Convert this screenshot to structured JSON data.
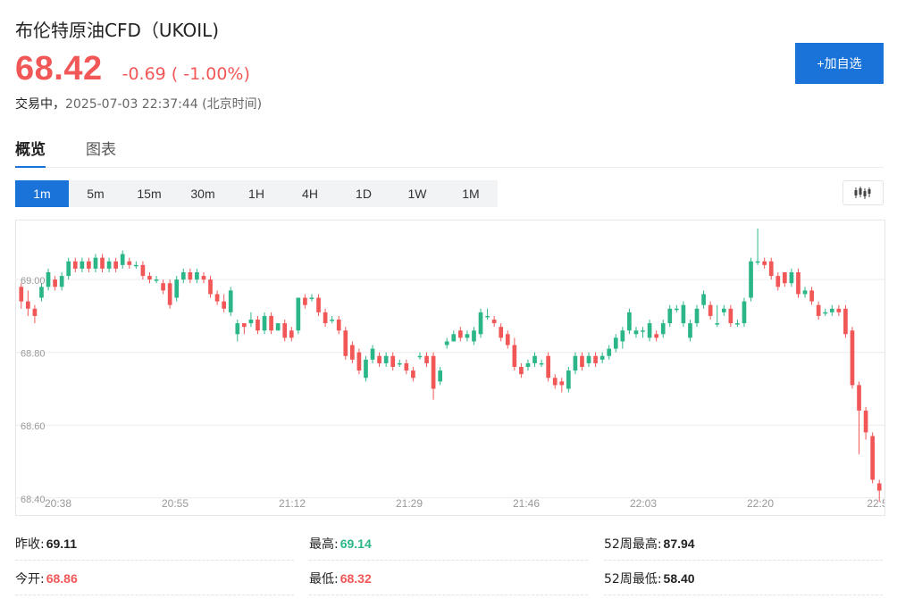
{
  "header": {
    "title": "布伦特原油CFD（UKOIL)",
    "price": "68.42",
    "change": "-0.69 ( -1.00%)",
    "status": "交易中，",
    "timestamp": "2025-07-03 22:37:44 (北京时间)"
  },
  "watchlist_button": "+加自选",
  "tabs": [
    "概览",
    "图表"
  ],
  "intervals": [
    "1m",
    "5m",
    "15m",
    "30m",
    "1H",
    "4H",
    "1D",
    "1W",
    "1M"
  ],
  "active_interval": "1m",
  "chart_type_icon": "candlestick-icon",
  "colors": {
    "up": "#2bb68a",
    "down": "#f25757",
    "accent": "#1a73d9"
  },
  "chart_data": {
    "type": "candlestick",
    "x_ticks": [
      "20:38",
      "20:55",
      "21:12",
      "21:29",
      "21:46",
      "22:03",
      "22:20",
      "22:5"
    ],
    "y_ticks": [
      "69.00",
      "68.80",
      "68.60",
      "68.40"
    ],
    "ylim": [
      68.37,
      69.15
    ],
    "grid": true,
    "candles": [
      [
        68.98,
        68.94,
        68.99,
        68.92
      ],
      [
        68.94,
        68.92,
        68.97,
        68.9
      ],
      [
        68.92,
        68.9,
        68.93,
        68.88
      ],
      [
        68.95,
        68.98,
        68.99,
        68.94
      ],
      [
        68.98,
        69.02,
        69.03,
        68.97
      ],
      [
        69.0,
        68.98,
        69.01,
        68.97
      ],
      [
        68.98,
        69.01,
        69.02,
        68.97
      ],
      [
        69.01,
        69.05,
        69.06,
        69.0
      ],
      [
        69.05,
        69.03,
        69.06,
        69.02
      ],
      [
        69.03,
        69.05,
        69.06,
        69.02
      ],
      [
        69.05,
        69.03,
        69.06,
        69.02
      ],
      [
        69.03,
        69.06,
        69.07,
        69.02
      ],
      [
        69.06,
        69.03,
        69.07,
        69.02
      ],
      [
        69.03,
        69.05,
        69.06,
        69.02
      ],
      [
        69.05,
        69.03,
        69.06,
        69.02
      ],
      [
        69.04,
        69.07,
        69.08,
        69.03
      ],
      [
        69.05,
        69.04,
        69.06,
        69.03
      ],
      [
        69.04,
        69.04,
        69.05,
        69.03
      ],
      [
        69.04,
        69.01,
        69.05,
        69.0
      ],
      [
        69.01,
        69.0,
        69.02,
        68.99
      ],
      [
        69.0,
        69.0,
        69.01,
        68.99
      ],
      [
        68.99,
        68.97,
        69.0,
        68.96
      ],
      [
        68.99,
        68.93,
        69.0,
        68.92
      ],
      [
        68.95,
        69.0,
        69.01,
        68.94
      ],
      [
        69.0,
        69.02,
        69.03,
        68.99
      ],
      [
        69.02,
        69.0,
        69.03,
        68.99
      ],
      [
        69.0,
        69.02,
        69.03,
        68.99
      ],
      [
        69.01,
        69.0,
        69.02,
        68.99
      ],
      [
        69.0,
        68.96,
        69.01,
        68.95
      ],
      [
        68.96,
        68.94,
        68.97,
        68.93
      ],
      [
        68.94,
        68.92,
        68.96,
        68.91
      ],
      [
        68.91,
        68.97,
        68.98,
        68.9
      ],
      [
        68.85,
        68.88,
        68.89,
        68.83
      ],
      [
        68.88,
        68.87,
        68.88,
        68.85
      ],
      [
        68.88,
        68.89,
        68.91,
        68.87
      ],
      [
        68.89,
        68.86,
        68.9,
        68.85
      ],
      [
        68.86,
        68.9,
        68.91,
        68.85
      ],
      [
        68.9,
        68.86,
        68.91,
        68.85
      ],
      [
        68.86,
        68.88,
        68.88,
        68.86
      ],
      [
        68.88,
        68.84,
        68.89,
        68.83
      ],
      [
        68.86,
        68.84,
        68.87,
        68.83
      ],
      [
        68.86,
        68.95,
        68.95,
        68.85
      ],
      [
        68.95,
        68.93,
        68.96,
        68.92
      ],
      [
        68.95,
        68.95,
        68.96,
        68.94
      ],
      [
        68.95,
        68.91,
        68.96,
        68.9
      ],
      [
        68.91,
        68.88,
        68.92,
        68.87
      ],
      [
        68.89,
        68.89,
        68.9,
        68.88
      ],
      [
        68.89,
        68.86,
        68.9,
        68.85
      ],
      [
        68.86,
        68.79,
        68.87,
        68.78
      ],
      [
        68.82,
        68.78,
        68.83,
        68.77
      ],
      [
        68.8,
        68.75,
        68.81,
        68.74
      ],
      [
        68.73,
        68.78,
        68.79,
        68.72
      ],
      [
        68.78,
        68.81,
        68.82,
        68.77
      ],
      [
        68.79,
        68.77,
        68.8,
        68.76
      ],
      [
        68.77,
        68.79,
        68.8,
        68.76
      ],
      [
        68.79,
        68.76,
        68.8,
        68.75
      ],
      [
        68.77,
        68.77,
        68.78,
        68.76
      ],
      [
        68.77,
        68.75,
        68.78,
        68.74
      ],
      [
        68.75,
        68.73,
        68.76,
        68.72
      ],
      [
        68.79,
        68.79,
        68.8,
        68.78
      ],
      [
        68.79,
        68.77,
        68.8,
        68.76
      ],
      [
        68.79,
        68.7,
        68.8,
        68.67
      ],
      [
        68.72,
        68.75,
        68.76,
        68.71
      ],
      [
        68.82,
        68.83,
        68.84,
        68.81
      ],
      [
        68.83,
        68.85,
        68.86,
        68.84
      ],
      [
        68.86,
        68.84,
        68.87,
        68.83
      ],
      [
        68.84,
        68.85,
        68.86,
        68.83
      ],
      [
        68.83,
        68.86,
        68.87,
        68.82
      ],
      [
        68.85,
        68.91,
        68.92,
        68.84
      ],
      [
        68.9,
        68.9,
        68.92,
        68.89
      ],
      [
        68.89,
        68.88,
        68.9,
        68.87
      ],
      [
        68.87,
        68.84,
        68.88,
        68.83
      ],
      [
        68.85,
        68.82,
        68.86,
        68.81
      ],
      [
        68.82,
        68.76,
        68.84,
        68.75
      ],
      [
        68.76,
        68.74,
        68.77,
        68.73
      ],
      [
        68.76,
        68.77,
        68.78,
        68.75
      ],
      [
        68.77,
        68.79,
        68.8,
        68.76
      ],
      [
        68.77,
        68.77,
        68.78,
        68.76
      ],
      [
        68.79,
        68.73,
        68.8,
        68.72
      ],
      [
        68.73,
        68.71,
        68.74,
        68.7
      ],
      [
        68.72,
        68.71,
        68.73,
        68.69
      ],
      [
        68.7,
        68.75,
        68.76,
        68.69
      ],
      [
        68.75,
        68.79,
        68.8,
        68.74
      ],
      [
        68.79,
        68.76,
        68.8,
        68.75
      ],
      [
        68.77,
        68.79,
        68.8,
        68.76
      ],
      [
        68.79,
        68.77,
        68.8,
        68.76
      ],
      [
        68.78,
        68.79,
        68.8,
        68.77
      ],
      [
        68.79,
        68.81,
        68.82,
        68.78
      ],
      [
        68.81,
        68.84,
        68.85,
        68.8
      ],
      [
        68.83,
        68.86,
        68.87,
        68.81
      ],
      [
        68.86,
        68.91,
        68.92,
        68.85
      ],
      [
        68.85,
        68.86,
        68.87,
        68.84
      ],
      [
        68.86,
        68.86,
        68.87,
        68.84
      ],
      [
        68.84,
        68.88,
        68.89,
        68.83
      ],
      [
        68.85,
        68.84,
        68.86,
        68.83
      ],
      [
        68.85,
        68.88,
        68.89,
        68.84
      ],
      [
        68.88,
        68.92,
        68.93,
        68.87
      ],
      [
        68.92,
        68.92,
        68.93,
        68.91
      ],
      [
        68.88,
        68.93,
        68.94,
        68.87
      ],
      [
        68.84,
        68.88,
        68.89,
        68.83
      ],
      [
        68.88,
        68.92,
        68.93,
        68.87
      ],
      [
        68.93,
        68.96,
        68.97,
        68.92
      ],
      [
        68.93,
        68.9,
        68.94,
        68.89
      ],
      [
        68.88,
        68.88,
        68.93,
        68.87
      ],
      [
        68.91,
        68.92,
        68.93,
        68.9
      ],
      [
        68.92,
        68.88,
        68.93,
        68.87
      ],
      [
        68.88,
        68.88,
        68.89,
        68.87
      ],
      [
        68.88,
        68.94,
        68.95,
        68.87
      ],
      [
        68.95,
        69.05,
        69.06,
        68.94
      ],
      [
        69.05,
        69.05,
        69.14,
        69.04
      ],
      [
        69.05,
        69.04,
        69.06,
        69.03
      ],
      [
        69.05,
        69.01,
        69.06,
        69.0
      ],
      [
        69.01,
        68.98,
        69.02,
        68.97
      ],
      [
        69.02,
        68.99,
        69.02,
        68.98
      ],
      [
        68.99,
        69.02,
        69.03,
        68.98
      ],
      [
        69.02,
        68.96,
        69.03,
        68.95
      ],
      [
        68.96,
        68.97,
        68.98,
        68.95
      ],
      [
        68.97,
        68.94,
        68.98,
        68.93
      ],
      [
        68.93,
        68.9,
        68.94,
        68.89
      ],
      [
        68.91,
        68.91,
        68.92,
        68.9
      ],
      [
        68.91,
        68.92,
        68.93,
        68.9
      ],
      [
        68.92,
        68.91,
        68.93,
        68.9
      ],
      [
        68.92,
        68.85,
        68.93,
        68.84
      ],
      [
        68.86,
        68.71,
        68.87,
        68.7
      ],
      [
        68.71,
        68.64,
        68.72,
        68.52
      ],
      [
        68.64,
        68.58,
        68.65,
        68.56
      ],
      [
        68.57,
        68.45,
        68.58,
        68.44
      ],
      [
        68.44,
        68.42,
        68.45,
        68.39
      ]
    ]
  },
  "stats": [
    {
      "label": "昨收:",
      "value": "69.11",
      "color": "dark"
    },
    {
      "label": "最高:",
      "value": "69.14",
      "color": "green"
    },
    {
      "label": "52周最高:",
      "value": "87.94",
      "color": "dark"
    },
    {
      "label": "今开:",
      "value": "68.86",
      "color": "red"
    },
    {
      "label": "最低:",
      "value": "68.32",
      "color": "red"
    },
    {
      "label": "52周最低:",
      "value": "58.40",
      "color": "dark"
    }
  ]
}
